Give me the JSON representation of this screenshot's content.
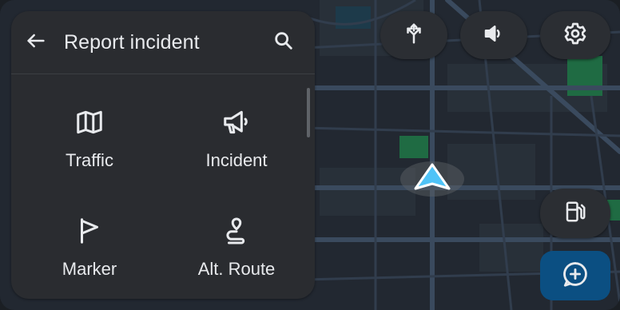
{
  "header": {
    "title": "Report incident",
    "back_icon": "arrow-back-icon",
    "search_icon": "search-icon"
  },
  "tiles": [
    {
      "label": "Traffic",
      "icon": "map-icon"
    },
    {
      "label": "Incident",
      "icon": "megaphone-icon"
    },
    {
      "label": "Marker",
      "icon": "flag-icon"
    },
    {
      "label": "Alt. Route",
      "icon": "route-icon"
    }
  ],
  "map_controls": {
    "alternate_routes_icon": "fork-arrows-icon",
    "sound_icon": "volume-icon",
    "settings_icon": "gear-icon",
    "gas_station_icon": "fuel-pump-icon",
    "assistant_icon": "chat-add-icon"
  },
  "colors": {
    "panel_bg": "#2a2c30",
    "map_bg": "#20252c",
    "road": "#3a4a5e",
    "park": "#1f6b43",
    "position_marker": "#4fc3f7",
    "chat_button": "#0b4f82"
  }
}
